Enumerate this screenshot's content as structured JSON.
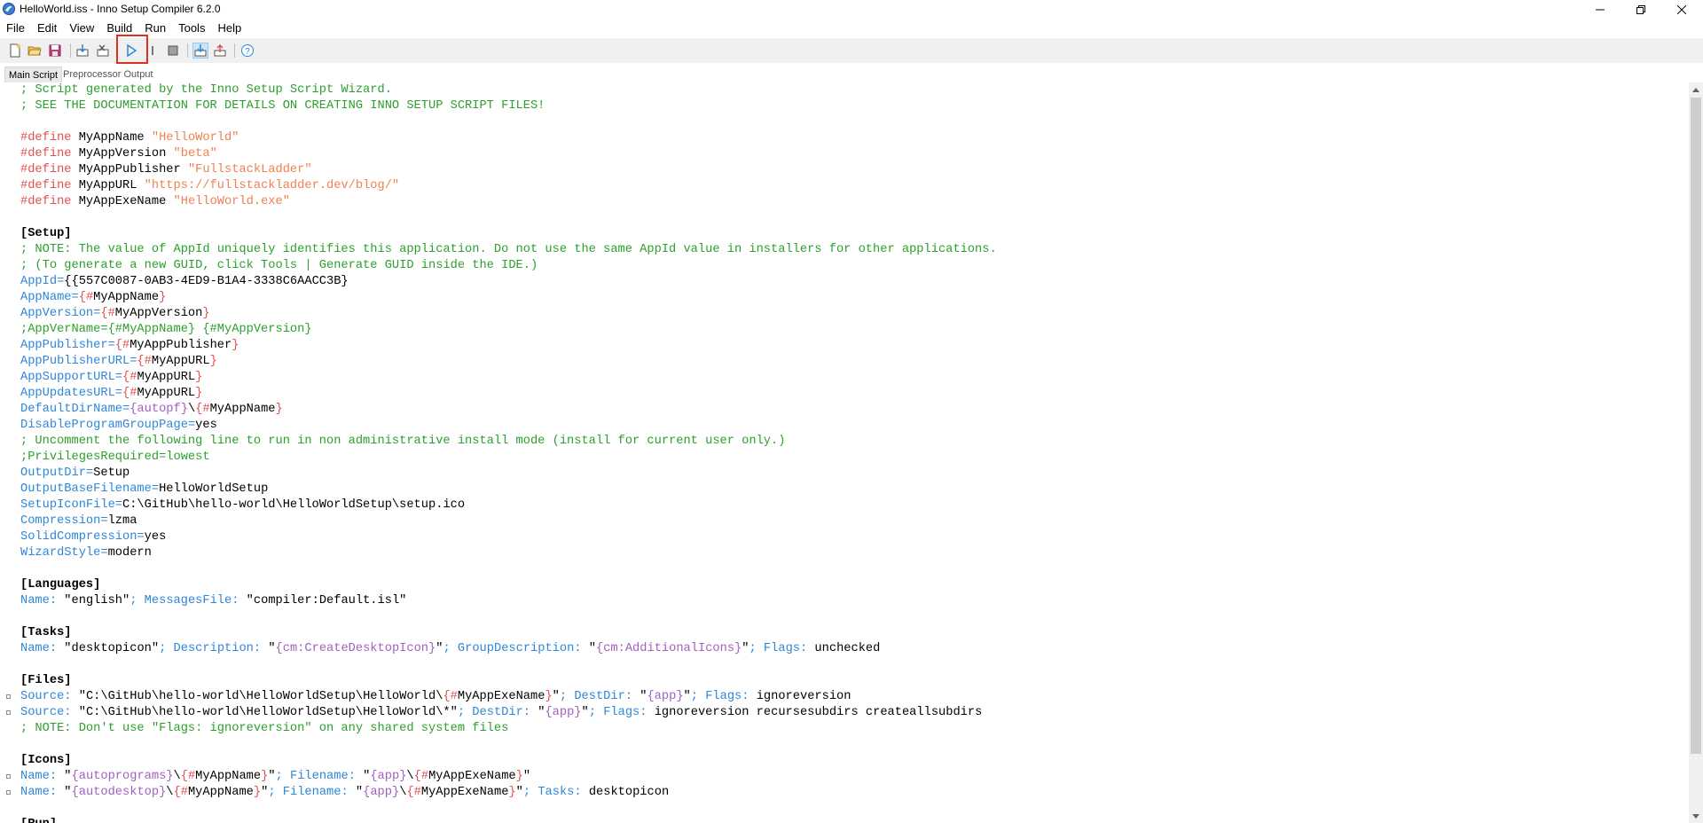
{
  "window": {
    "title": "HelloWorld.iss - Inno Setup Compiler 6.2.0"
  },
  "menu": [
    "File",
    "Edit",
    "View",
    "Build",
    "Run",
    "Tools",
    "Help"
  ],
  "toolbar": {
    "buttons": [
      "new-icon",
      "open-icon",
      "save-icon",
      "compile-icon",
      "stop-compile-icon",
      "run-icon",
      "pause-icon",
      "terminate-icon",
      "target-setup-icon",
      "target-uninstall-icon",
      "help-icon"
    ],
    "highlighted": "run-icon",
    "highlight_color": "#e0311f"
  },
  "tabs": [
    "Main Script",
    "Preprocessor Output"
  ],
  "active_tab": "Main Script",
  "colors": {
    "comment": "#2ca02c",
    "directive": "#e05050",
    "string": "#f08050",
    "key": "#2e86d8",
    "constant": "#a060c0"
  },
  "code": {
    "lines": [
      "; Script generated by the Inno Setup Script Wizard.",
      "; SEE THE DOCUMENTATION FOR DETAILS ON CREATING INNO SETUP SCRIPT FILES!",
      "",
      "#define MyAppName \"HelloWorld\"",
      "#define MyAppVersion \"beta\"",
      "#define MyAppPublisher \"FullstackLadder\"",
      "#define MyAppURL \"https://fullstackladder.dev/blog/\"",
      "#define MyAppExeName \"HelloWorld.exe\"",
      "",
      "[Setup]",
      "; NOTE: The value of AppId uniquely identifies this application. Do not use the same AppId value in installers for other applications.",
      "; (To generate a new GUID, click Tools | Generate GUID inside the IDE.)",
      "AppId={{557C0087-0AB3-4ED9-B1A4-3338C6AACC3B}",
      "AppName={#MyAppName}",
      "AppVersion={#MyAppVersion}",
      ";AppVerName={#MyAppName} {#MyAppVersion}",
      "AppPublisher={#MyAppPublisher}",
      "AppPublisherURL={#MyAppURL}",
      "AppSupportURL={#MyAppURL}",
      "AppUpdatesURL={#MyAppURL}",
      "DefaultDirName={autopf}\\{#MyAppName}",
      "DisableProgramGroupPage=yes",
      "; Uncomment the following line to run in non administrative install mode (install for current user only.)",
      ";PrivilegesRequired=lowest",
      "OutputDir=Setup",
      "OutputBaseFilename=HelloWorldSetup",
      "SetupIconFile=C:\\GitHub\\hello-world\\HelloWorldSetup\\setup.ico",
      "Compression=lzma",
      "SolidCompression=yes",
      "WizardStyle=modern",
      "",
      "[Languages]",
      "Name: \"english\"; MessagesFile: \"compiler:Default.isl\"",
      "",
      "[Tasks]",
      "Name: \"desktopicon\"; Description: \"{cm:CreateDesktopIcon}\"; GroupDescription: \"{cm:AdditionalIcons}\"; Flags: unchecked",
      "",
      "[Files]",
      "Source: \"C:\\GitHub\\hello-world\\HelloWorldSetup\\HelloWorld\\{#MyAppExeName}\"; DestDir: \"{app}\"; Flags: ignoreversion",
      "Source: \"C:\\GitHub\\hello-world\\HelloWorldSetup\\HelloWorld\\*\"; DestDir: \"{app}\"; Flags: ignoreversion recursesubdirs createallsubdirs",
      "; NOTE: Don't use \"Flags: ignoreversion\" on any shared system files",
      "",
      "[Icons]",
      "Name: \"{autoprograms}\\{#MyAppName}\"; Filename: \"{app}\\{#MyAppExeName}\"",
      "Name: \"{autodesktop}\\{#MyAppName}\"; Filename: \"{app}\\{#MyAppExeName}\"; Tasks: desktopicon",
      "",
      "[Run]"
    ],
    "fold_markers_on_lines": [
      38,
      39,
      43,
      44
    ]
  }
}
